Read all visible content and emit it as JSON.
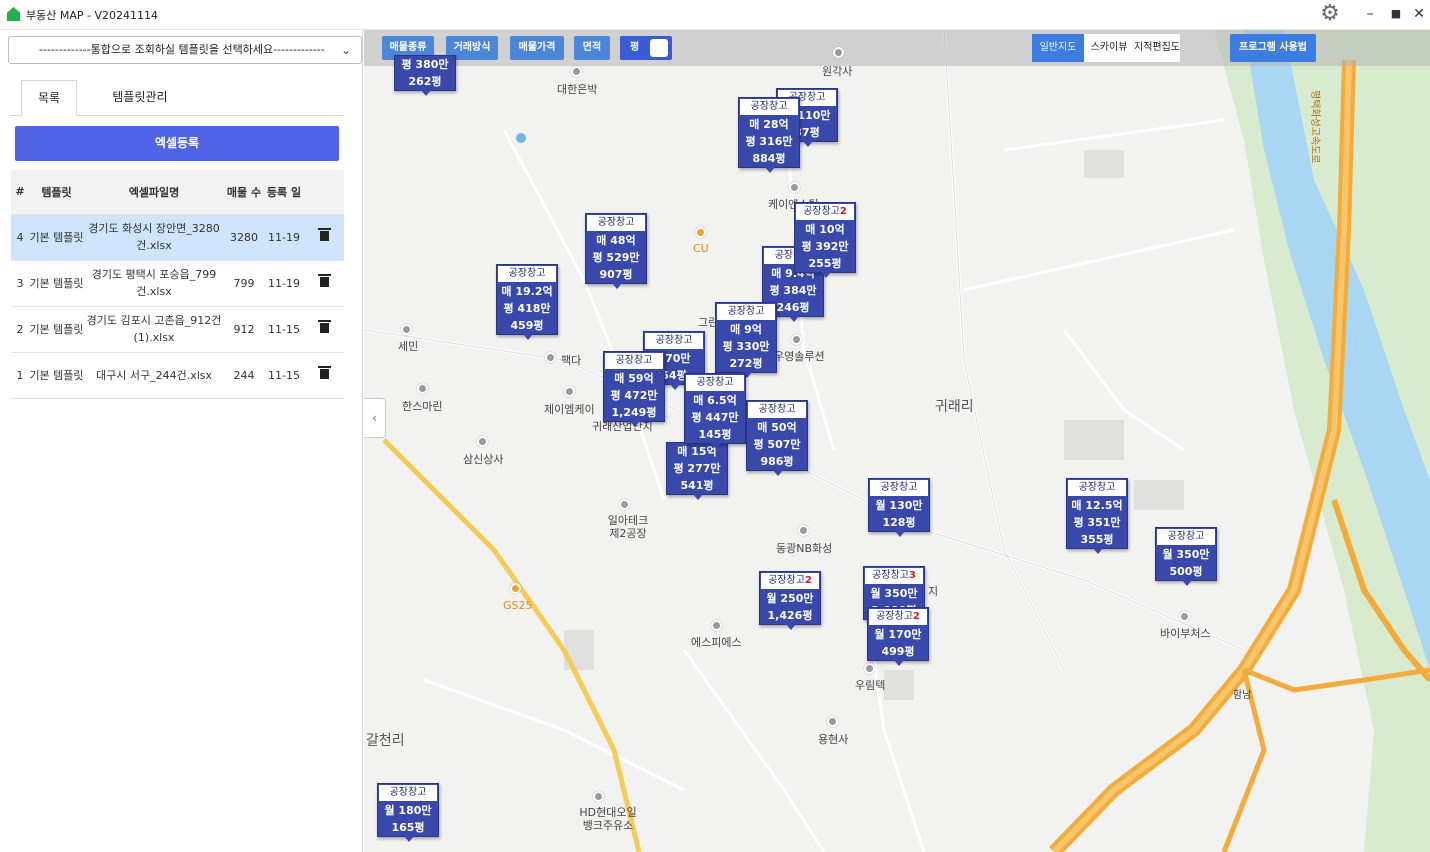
{
  "app": {
    "title": "부동산 MAP - V20241114"
  },
  "window": {
    "minimize": "–",
    "maximize": "■",
    "close": "✕"
  },
  "left": {
    "select_placeholder": "-------------통합으로 조회하실 템플릿을 선택하세요-------------",
    "tabs": [
      "목록",
      "템플릿관리"
    ],
    "excel_button": "엑셀등록",
    "table": {
      "headers": [
        "#",
        "템플릿",
        "엑셀파일명",
        "매물 수",
        "등록 일"
      ],
      "rows": [
        {
          "num": "4",
          "template": "기본 템플릿",
          "file": "경기도 화성시 장안면_3280건.xlsx",
          "count": "3280",
          "date": "11-19",
          "selected": true
        },
        {
          "num": "3",
          "template": "기본 템플릿",
          "file": "경기도 평택시 포승읍_799건.xlsx",
          "count": "799",
          "date": "11-19",
          "selected": false
        },
        {
          "num": "2",
          "template": "기본 템플릿",
          "file": "경기도 김포시 고촌읍_912건(1).xlsx",
          "count": "912",
          "date": "11-15",
          "selected": false
        },
        {
          "num": "1",
          "template": "기본 템플릿",
          "file": "대구시 서구_244건.xlsx",
          "count": "244",
          "date": "11-15",
          "selected": false
        }
      ]
    }
  },
  "toolbar": {
    "filters": [
      "매물종류",
      "거래방식",
      "매물가격",
      "면적"
    ],
    "toggle_label": "평",
    "map_types": [
      "일반지도",
      "스카이뷰",
      "지적편집도"
    ],
    "help": "프로그램 사용법"
  },
  "markers": [
    {
      "title": "",
      "count": "",
      "lines": [
        "평 380만",
        "262평"
      ]
    },
    {
      "title": "공장창고",
      "count": "",
      "lines": [
        "매 110만",
        "87평"
      ]
    },
    {
      "title": "공장창고",
      "count": "",
      "lines": [
        "매 28억",
        "평 316만",
        "884평"
      ]
    },
    {
      "title": "공장창고",
      "count": "2",
      "lines": [
        "매 10억",
        "평 392만",
        "255평"
      ]
    },
    {
      "title": "공장창고",
      "count": "",
      "lines": [
        "매 48억",
        "평 529만",
        "907평"
      ]
    },
    {
      "title": "공장창고",
      "count": "",
      "lines": [
        "매 9.4억",
        "평 384만",
        "246평"
      ]
    },
    {
      "title": "공장창고",
      "count": "",
      "lines": [
        "매 19.2억",
        "평 418만",
        "459평"
      ]
    },
    {
      "title": "공장창고",
      "count": "",
      "lines": [
        "매 9억",
        "평 330만",
        "272평"
      ]
    },
    {
      "title": "공장창고",
      "count": "",
      "lines": [
        "170만",
        "54평"
      ]
    },
    {
      "title": "공장창고",
      "count": "",
      "lines": [
        "매 59억",
        "평 472만",
        "1,249평"
      ]
    },
    {
      "title": "공장창고",
      "count": "",
      "lines": [
        "매 6.5억",
        "평 447만",
        "145평"
      ]
    },
    {
      "title": "공장창고",
      "count": "",
      "lines": [
        "매 50억",
        "평 507만",
        "986평"
      ]
    },
    {
      "title": "",
      "count": "",
      "lines": [
        "매 15억",
        "평 277만",
        "541평"
      ]
    },
    {
      "title": "공장창고",
      "count": "",
      "lines": [
        "월 130만",
        "128평"
      ]
    },
    {
      "title": "공장창고",
      "count": "",
      "lines": [
        "매 12.5억",
        "평 351만",
        "355평"
      ]
    },
    {
      "title": "공장창고",
      "count": "",
      "lines": [
        "월 350만",
        "500평"
      ]
    },
    {
      "title": "공장창고",
      "count": "2",
      "lines": [
        "월 250만",
        "1,426평"
      ]
    },
    {
      "title": "공장창고",
      "count": "3",
      "lines": [
        "월 350만",
        "2,000평"
      ]
    },
    {
      "title": "공장창고",
      "count": "2",
      "lines": [
        "월 170만",
        "499평"
      ]
    },
    {
      "title": "공장창고",
      "count": "",
      "lines": [
        "월 180만",
        "165평"
      ]
    }
  ],
  "places": [
    "원각사",
    "대한은박",
    "케이엔스틸",
    "CU",
    "그린",
    "세민",
    "팩다",
    "우영솔루션",
    "한스마린",
    "제이엠케이",
    "귀래산업단지",
    "삼신상사",
    "귀래리",
    "일아테크 제2공장",
    "동광NB화성",
    "GS25",
    "에스피에스",
    "우림텍",
    "용현사",
    "바이부처스",
    "지",
    "갈천리",
    "HD현대오일뱅크주유소",
    "함남",
    "평택화성고속도로"
  ]
}
